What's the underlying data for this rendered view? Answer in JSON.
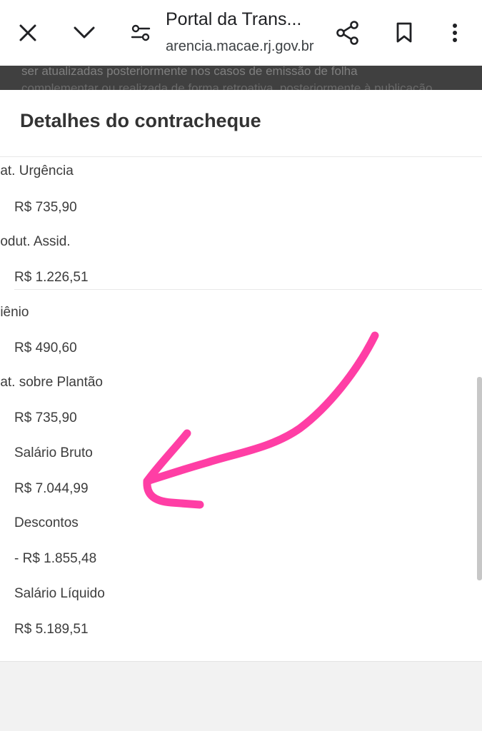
{
  "browser": {
    "page_title": "Portal da Trans...",
    "url": "arencia.macae.rj.gov.br",
    "icons": [
      "close-icon",
      "chevron-down-icon",
      "page-settings-icon",
      "share-icon",
      "bookmark-icon",
      "more-vert-icon"
    ]
  },
  "background_page": {
    "line1": "ser atualizadas posteriormente nos casos de emissão de folha",
    "line2": "complementar ou realizada de forma retroativa, posteriormente à publicação"
  },
  "sheet": {
    "title": "Detalhes do contracheque",
    "items": [
      {
        "label": "rat. Urgência",
        "value": "R$ 735,90"
      },
      {
        "label": "rodut. Assid.",
        "value": "R$ 1.226,51"
      },
      {
        "label": "riênio",
        "value": "R$ 490,60"
      },
      {
        "label": "rat. sobre Plantão",
        "value": "R$ 735,90"
      }
    ],
    "summary": [
      {
        "label": "Salário Bruto",
        "value": "R$ 7.044,99"
      },
      {
        "label": "Descontos",
        "value": "- R$ 1.855,48"
      },
      {
        "label": "Salário Líquido",
        "value": "R$ 5.189,51"
      }
    ]
  },
  "colors": {
    "annotation_arrow": "#ff3ea5",
    "sheet_background": "#ffffff",
    "toolbar_background": "#ffffff"
  }
}
